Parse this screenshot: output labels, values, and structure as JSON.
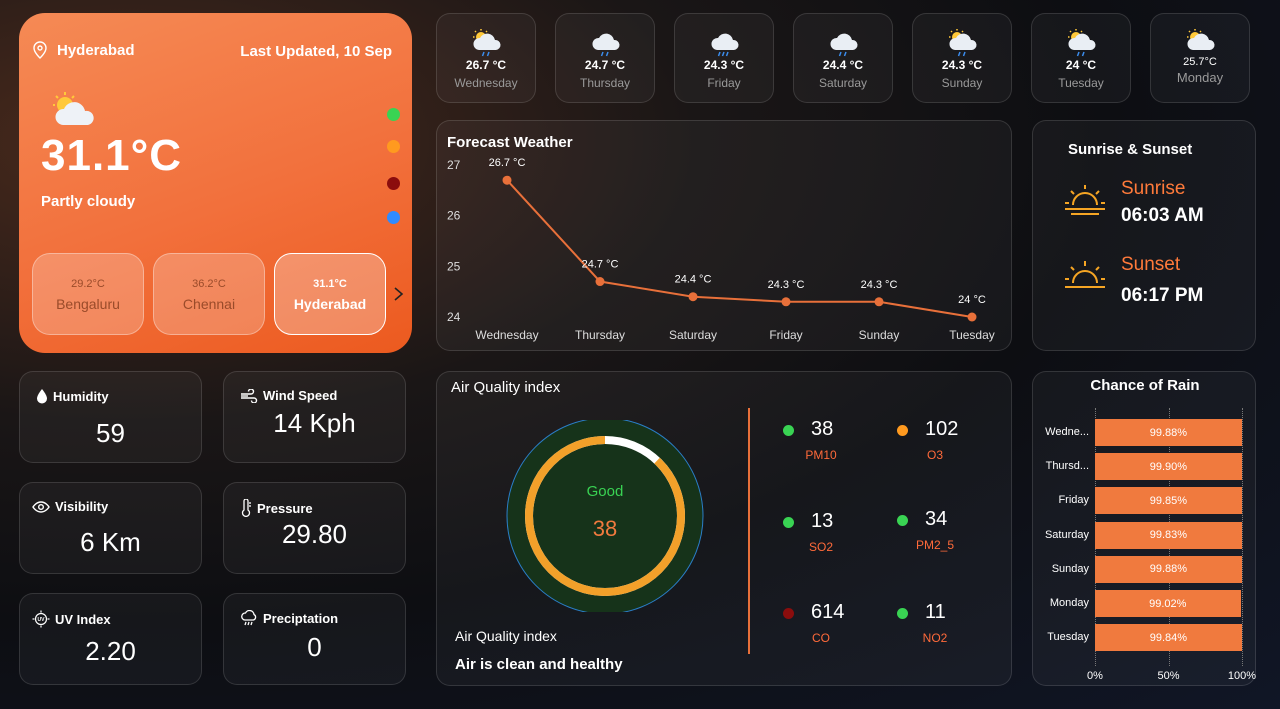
{
  "current": {
    "location": "Hyderabad",
    "last_updated": "Last Updated, 10 Sep",
    "temperature": "31.1°C",
    "condition": "Partly cloudy",
    "indicator_colors": [
      "#39d353",
      "#ff9a1f",
      "#8b0d0d",
      "#2f8bff"
    ],
    "cities": [
      {
        "temp": "29.2°C",
        "name": "Bengaluru",
        "selected": false
      },
      {
        "temp": "36.2°C",
        "name": "Chennai",
        "selected": false
      },
      {
        "temp": "31.1°C",
        "name": "Hyderabad",
        "selected": true
      }
    ]
  },
  "forecast_cards": [
    {
      "temp": "26.7 °C",
      "day": "Wednesday",
      "icon": "partly-cloudy-rain-icon"
    },
    {
      "temp": "24.7 °C",
      "day": "Thursday",
      "icon": "cloud-rain-icon"
    },
    {
      "temp": "24.3 °C",
      "day": "Friday",
      "icon": "cloud-heavy-rain-icon"
    },
    {
      "temp": "24.4 °C",
      "day": "Saturday",
      "icon": "cloud-rain-icon"
    },
    {
      "temp": "24.3 °C",
      "day": "Sunday",
      "icon": "partly-cloudy-rain-icon"
    },
    {
      "temp": "24 °C",
      "day": "Tuesday",
      "icon": "partly-cloudy-rain-icon"
    },
    {
      "temp": "25.7°C",
      "day": "Monday",
      "icon": "partly-cloudy-icon"
    }
  ],
  "forecast_chart_title": "Forecast Weather",
  "chart_data": [
    {
      "type": "line",
      "title": "Forecast Weather",
      "categories": [
        "Wednesday",
        "Thursday",
        "Saturday",
        "Friday",
        "Sunday",
        "Tuesday"
      ],
      "values": [
        26.7,
        24.7,
        24.4,
        24.3,
        24.3,
        24.0
      ],
      "data_labels": [
        "26.7 °C",
        "24.7 °C",
        "24.4 °C",
        "24.3 °C",
        "24.3 °C",
        "24 °C"
      ],
      "y_ticks": [
        "27",
        "26",
        "25",
        "24"
      ],
      "ylim": [
        24,
        27
      ],
      "color": "#e8703a",
      "grid": false
    },
    {
      "type": "bar",
      "orientation": "horizontal",
      "title": "Chance of Rain",
      "categories": [
        "Wedne...",
        "Thursd...",
        "Friday",
        "Saturday",
        "Sunday",
        "Monday",
        "Tuesday"
      ],
      "values": [
        99.88,
        99.9,
        99.85,
        99.83,
        99.88,
        99.02,
        99.84
      ],
      "data_labels": [
        "99.88%",
        "99.90%",
        "99.85%",
        "99.83%",
        "99.88%",
        "99.02%",
        "99.84%"
      ],
      "x_ticks": [
        "0%",
        "50%",
        "100%"
      ],
      "xlim": [
        0,
        100
      ],
      "color": "#f07a3e",
      "grid": true
    }
  ],
  "sun": {
    "title": "Sunrise & Sunset",
    "sunrise_label": "Sunrise",
    "sunrise_time": "06:03 AM",
    "sunset_label": "Sunset",
    "sunset_time": "06:17 PM"
  },
  "stats": {
    "humidity": {
      "label": "Humidity",
      "value": "59"
    },
    "wind": {
      "label": "Wind Speed",
      "value": "14 Kph"
    },
    "visibility": {
      "label": "Visibility",
      "value": "6 Km"
    },
    "pressure": {
      "label": "Pressure",
      "value": "29.80"
    },
    "uv": {
      "label": "UV Index",
      "value": "2.20"
    },
    "precip": {
      "label": "Preciptation",
      "value": "0"
    }
  },
  "aqi": {
    "title": "Air Quality index",
    "gauge_status": "Good",
    "gauge_value": "38",
    "gauge_fill_fraction": 0.88,
    "footer_title": "Air Quality index",
    "footer_text": "Air is clean and healthy",
    "pollutants": [
      {
        "value": "38",
        "name": "PM10",
        "color": "#39d353"
      },
      {
        "value": "102",
        "name": "O3",
        "color": "#ff9a1f"
      },
      {
        "value": "13",
        "name": "SO2",
        "color": "#39d353"
      },
      {
        "value": "34",
        "name": "PM2_5",
        "color": "#39d353"
      },
      {
        "value": "614",
        "name": "CO",
        "color": "#8b0d0d"
      },
      {
        "value": "11",
        "name": "NO2",
        "color": "#39d353"
      }
    ]
  },
  "rain_title": "Chance of Rain"
}
